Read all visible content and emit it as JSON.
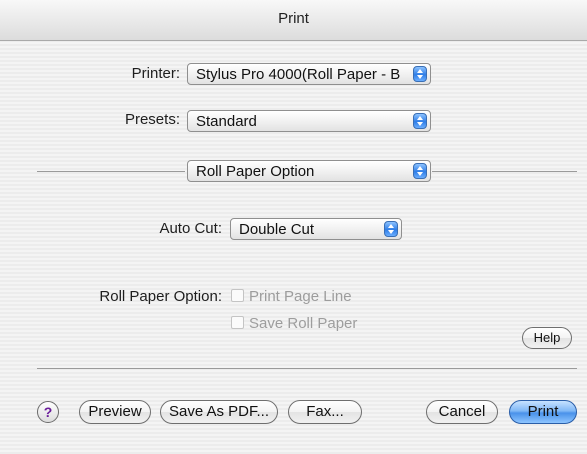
{
  "window": {
    "title": "Print"
  },
  "printer": {
    "label": "Printer:",
    "value": "Stylus Pro 4000(Roll Paper - B..."
  },
  "presets": {
    "label": "Presets:",
    "value": "Standard"
  },
  "panel": {
    "value": "Roll Paper Option"
  },
  "auto_cut": {
    "label": "Auto Cut:",
    "value": "Double Cut"
  },
  "roll_paper_option": {
    "label": "Roll Paper Option:",
    "checkboxes": [
      {
        "label": "Print Page Line",
        "checked": false,
        "enabled": false
      },
      {
        "label": "Save Roll Paper",
        "checked": false,
        "enabled": false
      }
    ]
  },
  "buttons": {
    "help": "Help",
    "question_mark": "?",
    "preview": "Preview",
    "save_as_pdf": "Save As PDF...",
    "fax": "Fax...",
    "cancel": "Cancel",
    "print": "Print"
  },
  "colors": {
    "default_button": "#4a92ea",
    "popup_arrow": "#2f7de6"
  }
}
